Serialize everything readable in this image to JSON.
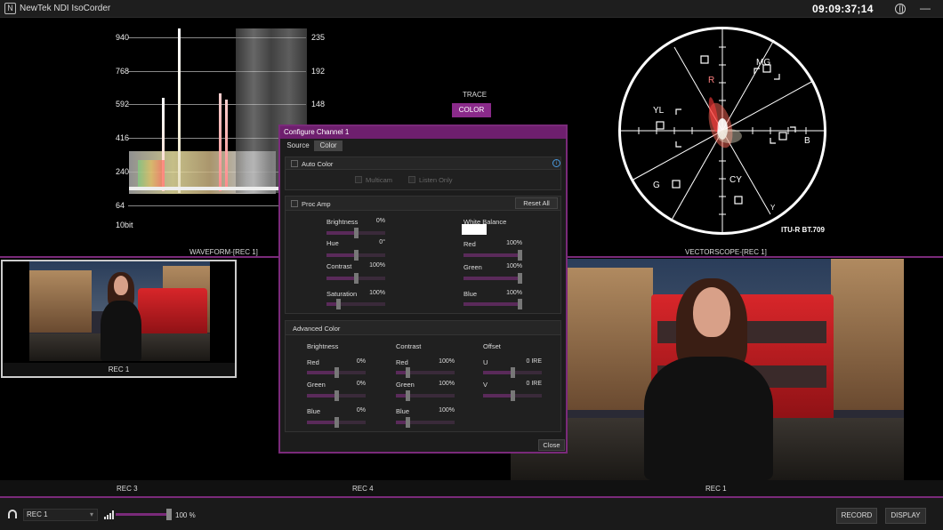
{
  "app": {
    "title": "NewTek NDI IsoCorder",
    "timecode": "09:09:37;14",
    "logo_glyph": "N",
    "minimize_glyph": "—"
  },
  "waveform": {
    "levels": [
      "940",
      "768",
      "592",
      "416",
      "240",
      "64"
    ],
    "right_levels": [
      "235",
      "192",
      "148"
    ],
    "bitdepth": "10bit",
    "caption": "WAVEFORM-[REC 1]"
  },
  "scope_buttons": {
    "trace": "TRACE",
    "color": "COLOR"
  },
  "vectorscope": {
    "targets": {
      "mg": "MG",
      "r": "R",
      "yl": "YL",
      "b": "B",
      "g": "G",
      "cy": "CY",
      "y": "Y"
    },
    "standard": "ITU-R BT.709",
    "caption": "VECTORSCOPE-[REC 1]"
  },
  "panels": {
    "rec1_small": "REC 1",
    "rec3": "REC 3",
    "rec4": "REC 4",
    "rec1_large": "REC 1"
  },
  "toolbar": {
    "source": "REC 1",
    "volume_pct": 100,
    "volume_label": "100 %",
    "record": "RECORD",
    "display": "DISPLAY"
  },
  "dialog": {
    "title": "Configure Channel 1",
    "tabs": [
      "Source",
      "Color"
    ],
    "active_tab": "Color",
    "auto_color": {
      "label": "Auto Color",
      "checked": false,
      "multicam": "Multicam",
      "listen_only": "Listen Only"
    },
    "proc_amp": {
      "label": "Proc Amp",
      "checked": false,
      "reset": "Reset All",
      "brightness": {
        "label": "Brightness",
        "value": "0%",
        "pos": 0.5
      },
      "hue": {
        "label": "Hue",
        "value": "0°",
        "pos": 0.5
      },
      "contrast": {
        "label": "Contrast",
        "value": "100%",
        "pos": 0.5
      },
      "saturation": {
        "label": "Saturation",
        "value": "100%",
        "pos": 0.2
      },
      "white_balance": {
        "label": "White Balance",
        "swatch": "#ffffff"
      },
      "red": {
        "label": "Red",
        "value": "100%",
        "pos": 1.0
      },
      "green": {
        "label": "Green",
        "value": "100%",
        "pos": 1.0
      },
      "blue": {
        "label": "Blue",
        "value": "100%",
        "pos": 1.0
      }
    },
    "advanced": {
      "label": "Advanced Color",
      "brightness": {
        "label": "Brightness",
        "red": {
          "label": "Red",
          "value": "0%",
          "pos": 0.5
        },
        "green": {
          "label": "Green",
          "value": "0%",
          "pos": 0.5
        },
        "blue": {
          "label": "Blue",
          "value": "0%",
          "pos": 0.5
        }
      },
      "contrast": {
        "label": "Contrast",
        "red": {
          "label": "Red",
          "value": "100%",
          "pos": 0.2
        },
        "green": {
          "label": "Green",
          "value": "100%",
          "pos": 0.2
        },
        "blue": {
          "label": "Blue",
          "value": "100%",
          "pos": 0.2
        }
      },
      "offset": {
        "label": "Offset",
        "u": {
          "label": "U",
          "value": "0 IRE",
          "pos": 0.5
        },
        "v": {
          "label": "V",
          "value": "0 IRE",
          "pos": 0.5
        }
      }
    },
    "close": "Close"
  },
  "colors": {
    "accent": "#7a2a7a",
    "button_active": "#8a2a8a"
  }
}
